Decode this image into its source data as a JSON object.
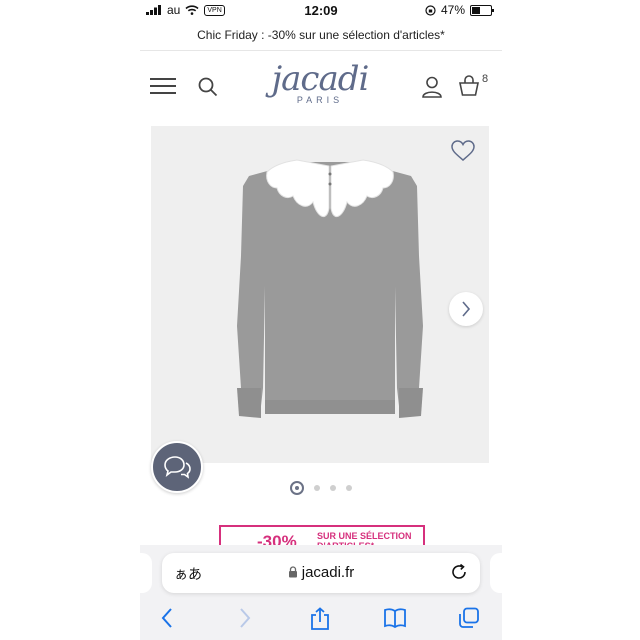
{
  "status_bar": {
    "carrier": "au",
    "vpn": "VPN",
    "time": "12:09",
    "battery": "47%",
    "battery_level": 0.47
  },
  "promo": {
    "text": "Chic Friday : -30% sur une sélection d'articles*"
  },
  "header": {
    "logo_word": "jacadi",
    "logo_sub": "PARIS",
    "bag_count": "8"
  },
  "carousel": {
    "total_slides": 4,
    "active_index": 0
  },
  "sale_strip": {
    "percent": "-30%",
    "line1": "SUR UNE SÉLECTION",
    "line2": "D'ARTICLES*"
  },
  "browser": {
    "aa_label": "ぁあ",
    "url": "jacadi.fr"
  },
  "icons": [
    "menu-icon",
    "search-icon",
    "account-icon",
    "bag-icon",
    "heart-icon",
    "chevron-right-icon",
    "chat-icon",
    "lock-icon",
    "reload-icon",
    "back-icon",
    "forward-icon",
    "share-icon",
    "bookmarks-icon",
    "tabs-icon"
  ],
  "colors": {
    "brand": "#5f6b8a",
    "sale": "#d6307d",
    "ios_blue": "#1a73e8",
    "chat_button": "#5d6478"
  }
}
